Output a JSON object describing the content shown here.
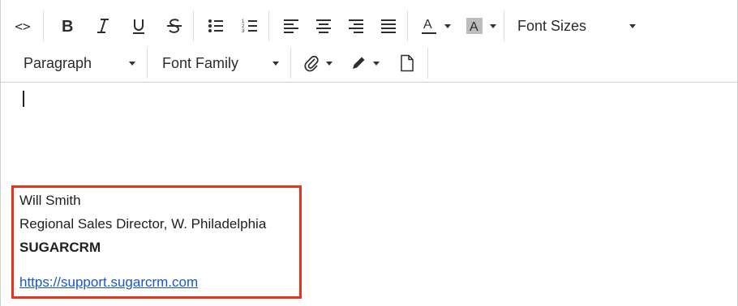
{
  "toolbar": {
    "row1": {
      "code_view": "<>",
      "font_sizes_label": "Font Sizes"
    },
    "row2": {
      "paragraph_label": "Paragraph",
      "font_family_label": "Font Family"
    }
  },
  "signature": {
    "name": "Will Smith",
    "title": "Regional Sales Director, W. Philadelphia",
    "company": "SUGARCRM",
    "link": "https://support.sugarcrm.com"
  },
  "colors": {
    "highlight_border": "#e8341c",
    "link": "#1a56c8"
  }
}
